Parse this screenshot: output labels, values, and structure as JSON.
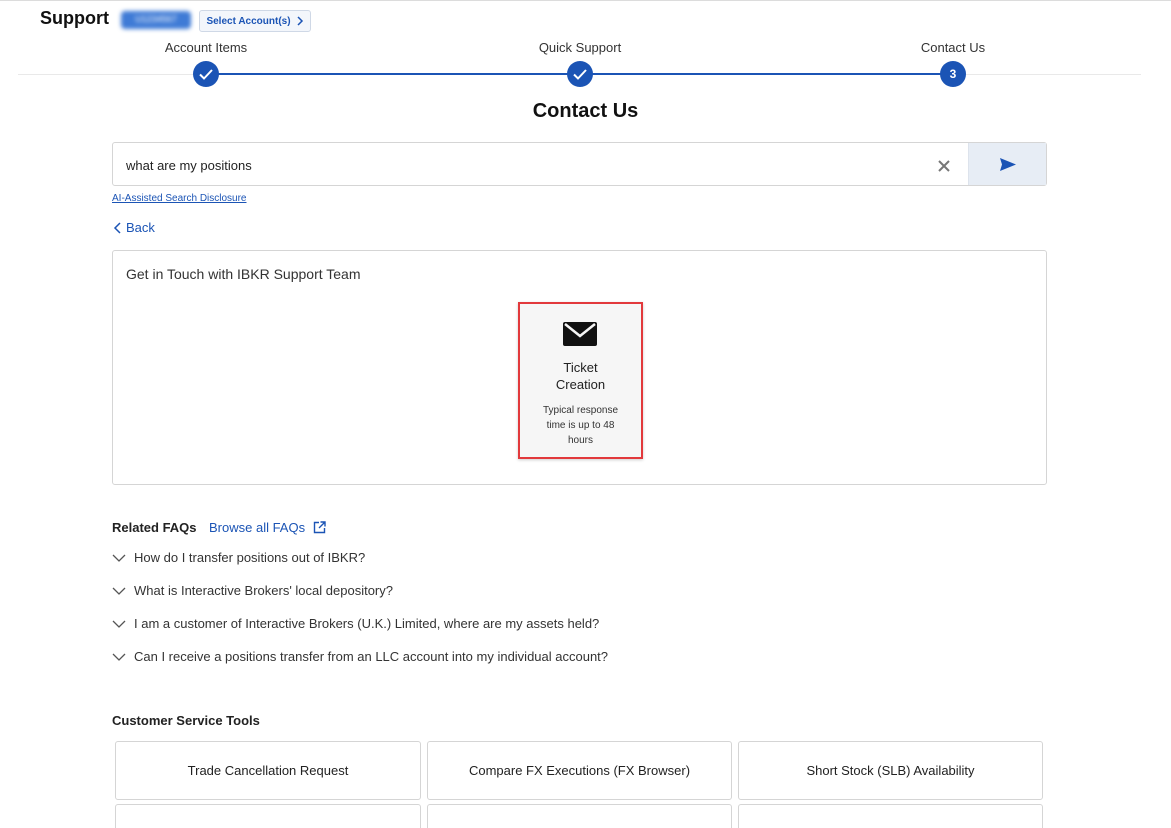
{
  "header": {
    "title": "Support",
    "account_badge": "U1234567",
    "select_accounts": "Select Account(s)"
  },
  "stepper": {
    "steps": [
      {
        "label": "Account Items",
        "state": "done"
      },
      {
        "label": "Quick Support",
        "state": "done"
      },
      {
        "label": "Contact Us",
        "state": "current",
        "number": "3"
      }
    ]
  },
  "page": {
    "heading": "Contact Us"
  },
  "search": {
    "value": "what are my positions",
    "disclosure": "AI-Assisted Search Disclosure"
  },
  "nav": {
    "back": "Back"
  },
  "contact": {
    "title": "Get in Touch with IBKR Support Team",
    "ticket_title_line1": "Ticket",
    "ticket_title_line2": "Creation",
    "ticket_sub_line1": "Typical response",
    "ticket_sub_line2": "time is up to 48",
    "ticket_sub_line3": "hours"
  },
  "faq": {
    "heading": "Related FAQs",
    "browse": "Browse all FAQs",
    "items": [
      "How do I transfer positions out of IBKR?",
      "What is Interactive Brokers' local depository?",
      "I am a customer of Interactive Brokers (U.K.) Limited, where are my assets held?",
      "Can I receive a positions transfer from an LLC account into my individual account?"
    ]
  },
  "tools": {
    "heading": "Customer Service Tools",
    "items": [
      "Trade Cancellation Request",
      "Compare FX Executions (FX Browser)",
      "Short Stock (SLB) Availability"
    ]
  },
  "colors": {
    "accent": "#1b54b5",
    "highlight": "#e2393c"
  }
}
